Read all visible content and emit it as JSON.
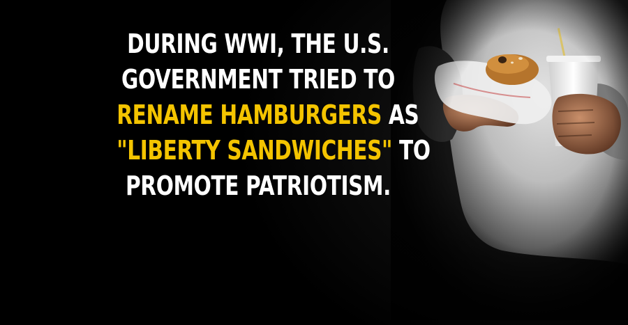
{
  "colors": {
    "background": "#000000",
    "text": "#ffffff",
    "highlight": "#f4c400"
  },
  "headline": {
    "line1": "DURING WWI, THE U.S.",
    "line2": "GOVERNMENT TRIED TO",
    "line3_highlight": "RENAME HAMBURGERS",
    "line3_rest": " AS",
    "line4_highlight": "\"LIBERTY SANDWICHES\"",
    "line4_rest": " TO",
    "line5": "PROMOTE PATRIOTISM."
  },
  "image": {
    "subject": "man holding hamburger and soda cup",
    "icons": [
      "hamburger-icon",
      "soda-cup-icon"
    ]
  }
}
